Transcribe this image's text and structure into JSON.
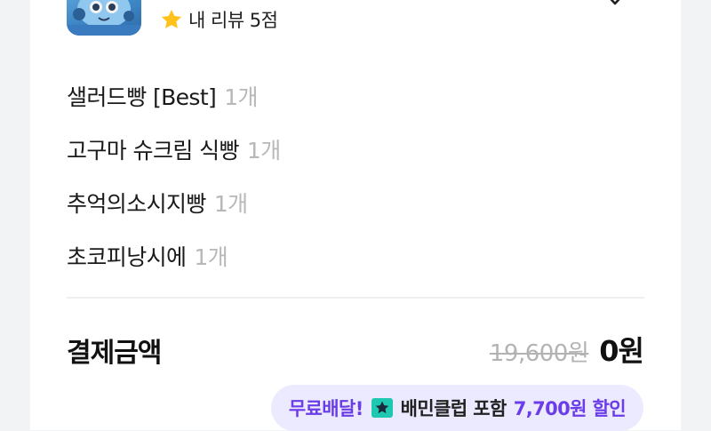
{
  "review": {
    "icon": "star-icon",
    "text": "내 리뷰 5점"
  },
  "items": [
    {
      "name": "샐러드빵 [Best]",
      "qty": "1개"
    },
    {
      "name": "고구마 슈크림 식빵",
      "qty": "1개"
    },
    {
      "name": "추억의소시지빵",
      "qty": "1개"
    },
    {
      "name": "초코피낭시에",
      "qty": "1개"
    }
  ],
  "payment": {
    "label": "결제금액",
    "original_price": "19,600원",
    "final_price": "0원"
  },
  "promo": {
    "free_delivery": "무료배달!",
    "club_text": "배민클럽 포함",
    "discount": "7,700원 할인",
    "icon": "baemin-club-icon"
  },
  "colors": {
    "accent_purple": "#6a3de8",
    "promo_bg": "#eceaff",
    "club_teal": "#1fc8b0",
    "star_yellow": "#ffc21a"
  }
}
